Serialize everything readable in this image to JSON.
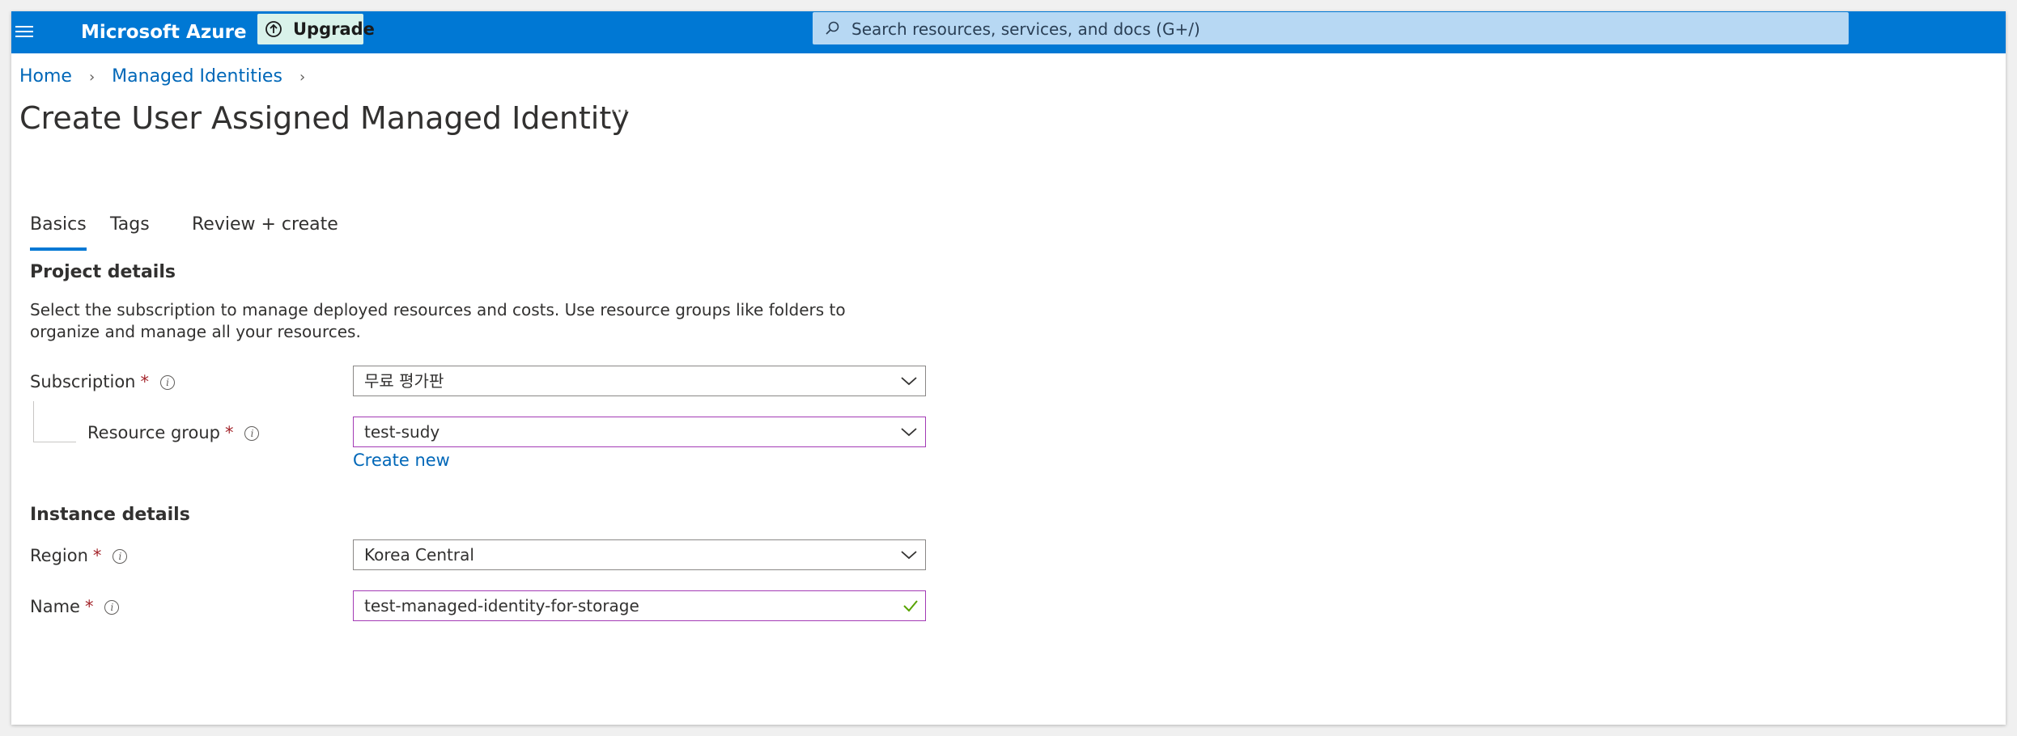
{
  "topbar": {
    "brand": "Microsoft Azure",
    "upgrade_label": "Upgrade",
    "search_placeholder": "Search resources, services, and docs (G+/)",
    "color": "#0078d4"
  },
  "breadcrumb": {
    "items": [
      "Home",
      "Managed Identities"
    ]
  },
  "page": {
    "title": "Create User Assigned Managed Identity",
    "more": "···"
  },
  "tabs": [
    {
      "label": "Basics",
      "active": true
    },
    {
      "label": "Tags",
      "active": false
    },
    {
      "label": "Review + create",
      "active": false
    }
  ],
  "project": {
    "title": "Project details",
    "description": "Select the subscription to manage deployed resources and costs. Use resource groups like folders to organize and manage all your resources.",
    "subscription": {
      "label": "Subscription",
      "required": "*",
      "value": "무료 평가판"
    },
    "resource_group": {
      "label": "Resource group",
      "required": "*",
      "value": "test-sudy",
      "create_new": "Create new"
    }
  },
  "instance": {
    "title": "Instance details",
    "region": {
      "label": "Region",
      "required": "*",
      "value": "Korea Central"
    },
    "name": {
      "label": "Name",
      "required": "*",
      "value": "test-managed-identity-for-storage",
      "valid": true
    }
  },
  "icons": [
    "hamburger-icon",
    "upgrade-icon",
    "search-icon",
    "chevron-right-icon",
    "info-icon",
    "chevron-down-icon",
    "checkmark-icon"
  ],
  "colors": {
    "accent": "#0078d4",
    "link": "#0067b8",
    "required": "#a4262c",
    "focus_border": "#a33ab5",
    "valid": "#57a300"
  }
}
